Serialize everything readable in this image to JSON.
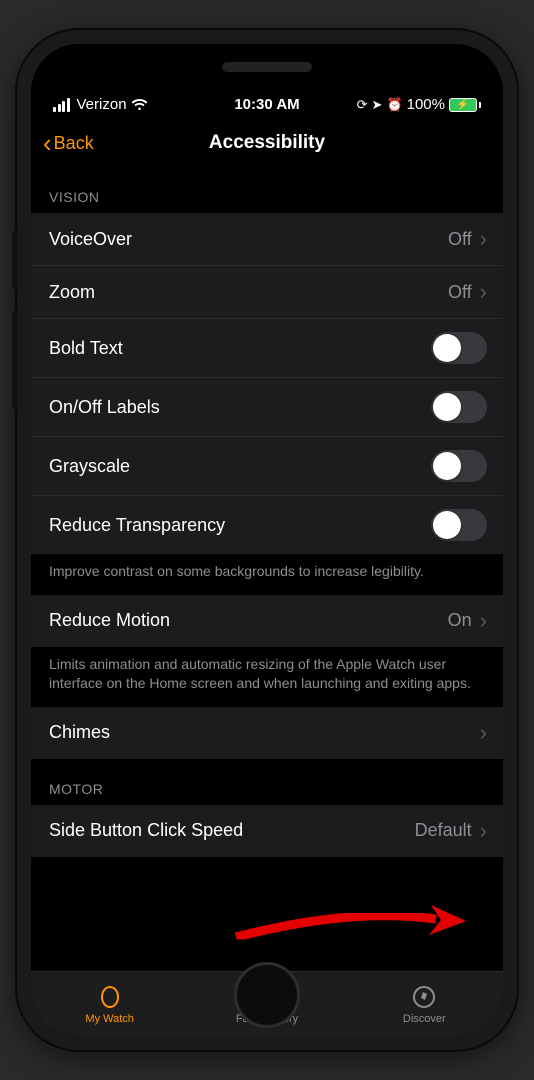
{
  "statusbar": {
    "carrier": "Verizon",
    "time": "10:30 AM",
    "battery_pct": "100%"
  },
  "nav": {
    "back_label": "Back",
    "title": "Accessibility"
  },
  "sections": {
    "vision_header": "VISION",
    "motor_header": "MOTOR"
  },
  "rows": {
    "voiceover": {
      "label": "VoiceOver",
      "value": "Off"
    },
    "zoom": {
      "label": "Zoom",
      "value": "Off"
    },
    "bold_text": {
      "label": "Bold Text"
    },
    "onoff_labels": {
      "label": "On/Off Labels"
    },
    "grayscale": {
      "label": "Grayscale"
    },
    "reduce_transparency": {
      "label": "Reduce Transparency"
    },
    "reduce_motion": {
      "label": "Reduce Motion",
      "value": "On"
    },
    "chimes": {
      "label": "Chimes"
    },
    "side_button": {
      "label": "Side Button Click Speed",
      "value": "Default"
    }
  },
  "footers": {
    "transparency": "Improve contrast on some backgrounds to increase legibility.",
    "motion": "Limits animation and automatic resizing of the Apple Watch user interface on the Home screen and when launching and exiting apps."
  },
  "tabs": {
    "mywatch": "My Watch",
    "facegallery": "Face Gallery",
    "discover": "Discover"
  }
}
